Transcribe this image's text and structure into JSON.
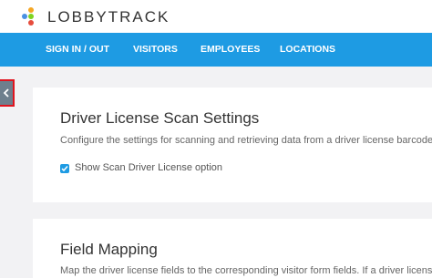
{
  "app": {
    "logo_text": "LOBBYTRACK",
    "logo_colors": [
      "#f5a623",
      "#4a90e2",
      "#7ed321",
      "#e64d3d"
    ]
  },
  "nav": {
    "items": [
      {
        "label": "SIGN IN / OUT"
      },
      {
        "label": "VISITORS"
      },
      {
        "label": "EMPLOYEES"
      },
      {
        "label": "LOCATIONS"
      }
    ],
    "color": "#1e9be3"
  },
  "sidebar_toggle": {
    "icon": "chevron-left-icon"
  },
  "scan_settings": {
    "title": "Driver License Scan Settings",
    "description": "Configure the settings for scanning and retrieving data from a driver license barcode.",
    "option_label": "Show Scan Driver License option",
    "option_checked": true
  },
  "field_mapping": {
    "title": "Field Mapping",
    "description": "Map the driver license fields to the corresponding visitor form fields. If a driver license"
  }
}
